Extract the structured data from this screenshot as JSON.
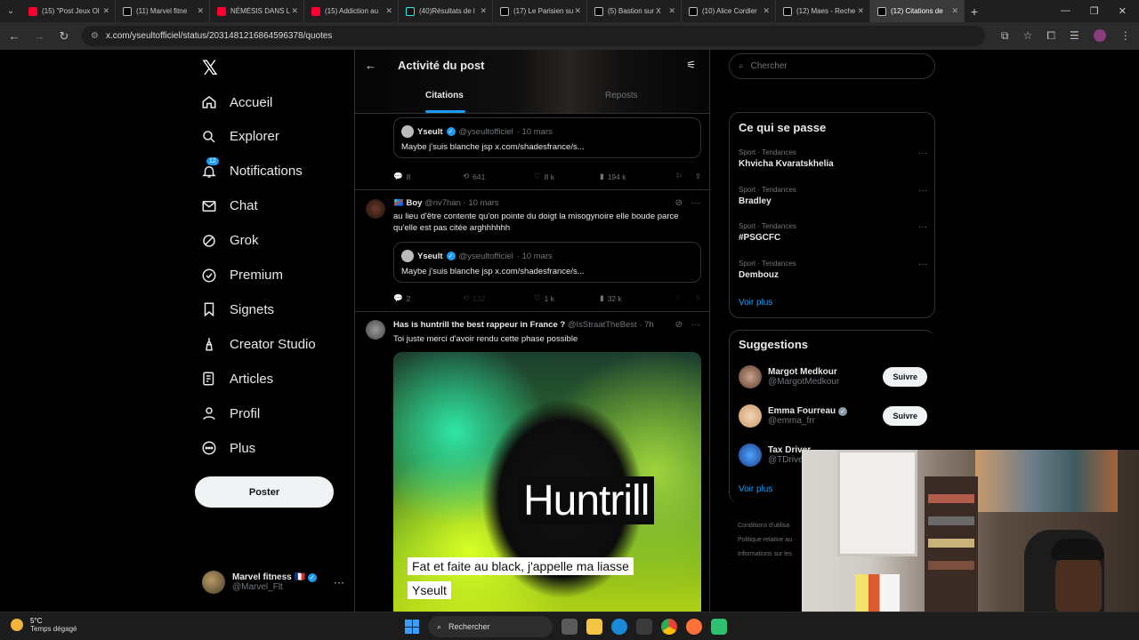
{
  "browser": {
    "tabs": [
      {
        "title": "(15) \"Post Jeux Ol",
        "type": "yt"
      },
      {
        "title": "(11) Marvel fitne",
        "type": "x"
      },
      {
        "title": "NÉMÉSIS DANS L",
        "type": "yt"
      },
      {
        "title": "(15) Addiction au",
        "type": "yt"
      },
      {
        "title": "(40)Résultats de l",
        "type": "tt"
      },
      {
        "title": "(17) Le Parisien su",
        "type": "x"
      },
      {
        "title": "(5) Bastion sur X",
        "type": "x"
      },
      {
        "title": "(10) Alice Cordier",
        "type": "x"
      },
      {
        "title": "(12) Maes - Reche",
        "type": "x"
      },
      {
        "title": "(12) Citations de",
        "type": "x",
        "active": true
      }
    ],
    "url": "x.com/yseultofficiel/status/2031481216864596378/quotes"
  },
  "nav": {
    "items": [
      {
        "label": "Accueil",
        "icon": "home-icon"
      },
      {
        "label": "Explorer",
        "icon": "search-icon"
      },
      {
        "label": "Notifications",
        "icon": "bell-icon",
        "badge": "12"
      },
      {
        "label": "Chat",
        "icon": "mail-icon"
      },
      {
        "label": "Grok",
        "icon": "grok-icon"
      },
      {
        "label": "Premium",
        "icon": "premium-icon"
      },
      {
        "label": "Signets",
        "icon": "bookmark-icon"
      },
      {
        "label": "Creator Studio",
        "icon": "creator-icon"
      },
      {
        "label": "Articles",
        "icon": "article-icon"
      },
      {
        "label": "Profil",
        "icon": "user-icon"
      },
      {
        "label": "Plus",
        "icon": "more-icon"
      }
    ],
    "post_button": "Poster",
    "account": {
      "name": "Marvel fitness",
      "flag": "🇫🇷",
      "handle": "@Marvel_Flt"
    }
  },
  "main": {
    "title": "Activité du post",
    "tabs": {
      "citations": "Citations",
      "reposts": "Reposts"
    },
    "post1": {
      "quote": {
        "name": "Yseult",
        "handle": "@yseultofficiel",
        "date": "· 10 mars",
        "text": "Maybe j'suis blanche jsp x.com/shadesfrance/s..."
      },
      "replies": "8",
      "reposts": "641",
      "likes": "8 k",
      "views": "194 k"
    },
    "post2": {
      "name": "Boy",
      "handle": "@nv7han",
      "date": "· 10 mars",
      "text": "au lieu d'être contente qu'on pointe du doigt la misogynoire elle boude parce qu'elle est pas citée arghhhhhh",
      "quote": {
        "name": "Yseult",
        "handle": "@yseultofficiel",
        "date": "· 10 mars",
        "text": "Maybe j'suis blanche jsp x.com/shadesfrance/s..."
      },
      "replies": "2",
      "reposts": "132",
      "likes": "1 k",
      "views": "32 k"
    },
    "post3": {
      "name": "Has is huntrill the best rappeur in France ?",
      "handle": "@IsStraatTheBest",
      "date": "· 7h",
      "text": "Toi juste merci d'avoir rendu cette phase possible",
      "media": {
        "big_text": "Huntrill",
        "caption1": "Fat et faite au black, j'appelle ma liasse",
        "caption2": "Yseult"
      }
    }
  },
  "right": {
    "search_placeholder": "Chercher",
    "trends_title": "Ce qui se passe",
    "trends": [
      {
        "category": "Sport · Tendances",
        "name": "Khvicha Kvaratskhelia"
      },
      {
        "category": "Sport · Tendances",
        "name": "Bradley"
      },
      {
        "category": "Sport · Tendances",
        "name": "#PSGCFC"
      },
      {
        "category": "Sport · Tendances",
        "name": "Dembouz"
      }
    ],
    "see_more": "Voir plus",
    "suggestions_title": "Suggestions",
    "suggestions": [
      {
        "name": "Margot Medkour",
        "handle": "@MargotMedkour",
        "button": "Suivre"
      },
      {
        "name": "Emma Fourreau",
        "handle": "@emma_frr",
        "button": "Suivre"
      },
      {
        "name": "Tax Driver",
        "handle": "@TDrive"
      }
    ],
    "footer": [
      "Conditions d'utilisa",
      "Politique relative au",
      "Informations sur les"
    ]
  },
  "taskbar": {
    "temp": "5°C",
    "weather": "Temps dégagé",
    "search": "Rechercher"
  }
}
